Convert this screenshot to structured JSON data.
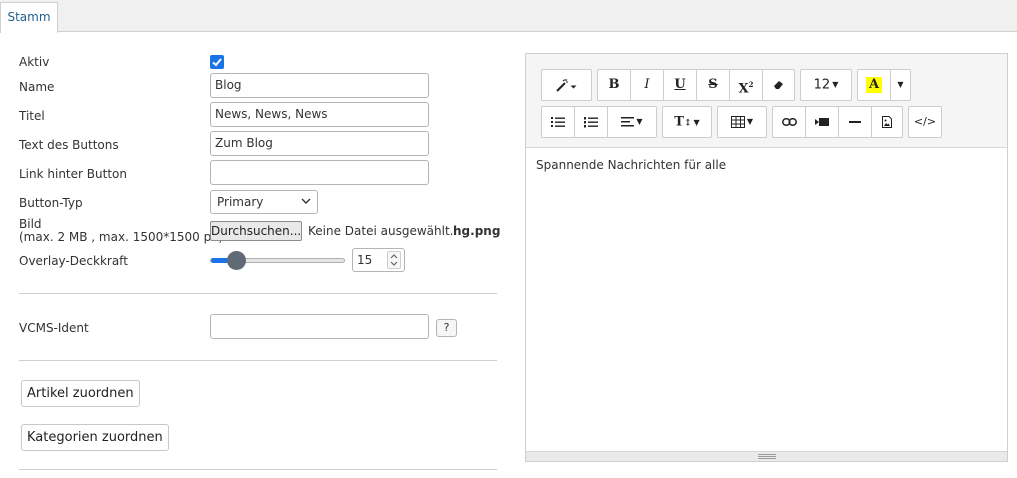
{
  "tabs": [
    {
      "label": "Stamm",
      "active": true
    }
  ],
  "form": {
    "aktiv": {
      "label": "Aktiv",
      "checked": true
    },
    "name": {
      "label": "Name",
      "value": "Blog"
    },
    "titel": {
      "label": "Titel",
      "value": "News, News, News"
    },
    "button_text": {
      "label": "Text des Buttons",
      "value": "Zum Blog"
    },
    "button_link": {
      "label": "Link hinter Button",
      "value": ""
    },
    "button_typ": {
      "label": "Button-Typ",
      "selected": "Primary"
    },
    "bild": {
      "label_line1": "Bild",
      "label_line2": "(max. 2 MB , max. 1500*1500 px)",
      "browse_label": "Durchsuchen...",
      "no_file_text": "Keine Datei ausgewählt.",
      "current_file": "hg.png"
    },
    "overlay": {
      "label": "Overlay-Deckkraft",
      "value": "15",
      "fraction": 0.15
    },
    "vcms_ident": {
      "label": "VCMS-Ident",
      "value": "",
      "help_label": "?"
    },
    "buttons": {
      "artikel": "Artikel zuordnen",
      "kategorien": "Kategorien zuordnen"
    }
  },
  "editor": {
    "font_size": "12",
    "content": "Spannende Nachrichten für alle",
    "toolbar_icons": [
      "magic-icon",
      "bold-icon",
      "italic-icon",
      "underline-icon",
      "strikethrough-icon",
      "superscript-icon",
      "eraser-icon",
      "font-size-dropdown",
      "text-color-icon",
      "text-color-dropdown",
      "unordered-list-icon",
      "ordered-list-icon",
      "align-icon",
      "line-height-icon",
      "table-icon",
      "link-icon",
      "video-icon",
      "horizontal-rule-icon",
      "image-icon",
      "code-view-icon"
    ],
    "highlight_color": "#ffff00"
  },
  "colors": {
    "accent": "#1a73e8",
    "tab_text": "#1f5f8f"
  }
}
